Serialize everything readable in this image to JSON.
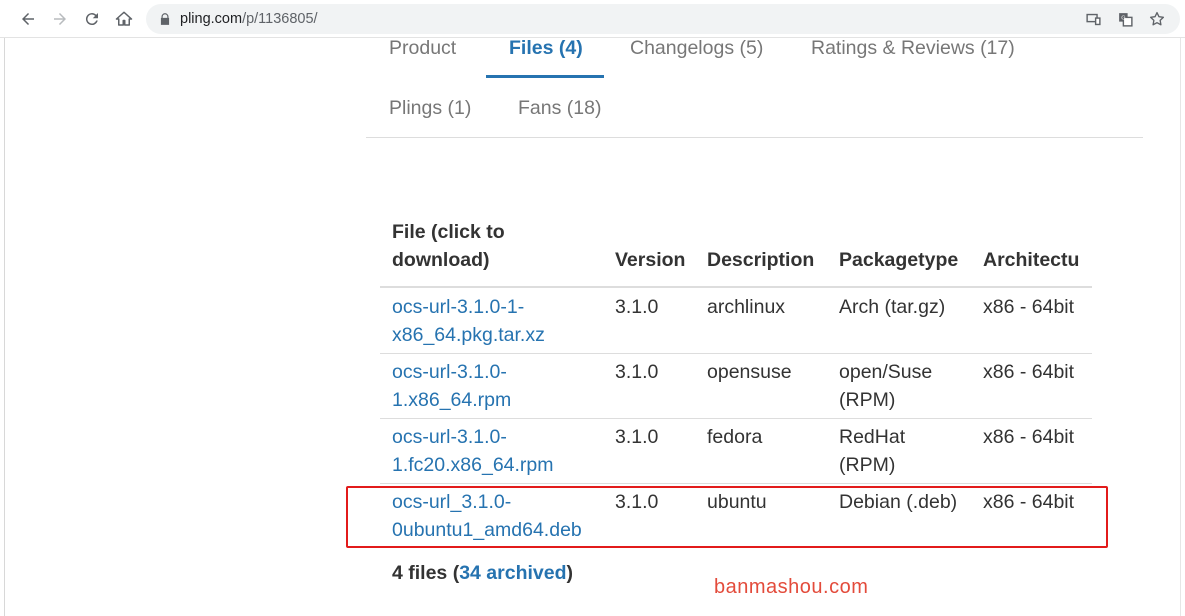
{
  "browser": {
    "url_host": "pling.com",
    "url_path": "/p/1136805/"
  },
  "tabs": [
    {
      "label": "Product"
    },
    {
      "label": "Files (4)"
    },
    {
      "label": "Changelogs (5)"
    },
    {
      "label": "Ratings & Reviews (17)"
    },
    {
      "label": "Plings (1)"
    },
    {
      "label": "Fans (18)"
    }
  ],
  "table": {
    "headers": {
      "file_line1": "File (click to",
      "file_line2": "download)",
      "version": "Version",
      "description": "Description",
      "packagetype": "Packagetype",
      "architecture": "Architectu"
    },
    "rows": [
      {
        "file_line1": "ocs-url-3.1.0-1-",
        "file_line2": "x86_64.pkg.tar.xz",
        "version": "3.1.0",
        "description": "archlinux",
        "pkg_line1": "Arch (tar.gz)",
        "pkg_line2": "",
        "arch": "x86 - 64bit"
      },
      {
        "file_line1": "ocs-url-3.1.0-",
        "file_line2": "1.x86_64.rpm",
        "version": "3.1.0",
        "description": "opensuse",
        "pkg_line1": "open/Suse",
        "pkg_line2": "(RPM)",
        "arch": "x86 - 64bit"
      },
      {
        "file_line1": "ocs-url-3.1.0-",
        "file_line2": "1.fc20.x86_64.rpm",
        "version": "3.1.0",
        "description": "fedora",
        "pkg_line1": "RedHat",
        "pkg_line2": "(RPM)",
        "arch": "x86 - 64bit"
      },
      {
        "file_line1": "ocs-url_3.1.0-",
        "file_line2": "0ubuntu1_amd64.deb",
        "version": "3.1.0",
        "description": "ubuntu",
        "pkg_line1": "Debian (.deb)",
        "pkg_line2": "",
        "arch": "x86 - 64bit"
      }
    ]
  },
  "summary": {
    "prefix": "4 files (",
    "archived_link": "34 archived",
    "suffix": ")"
  },
  "watermark": "banmashou.com",
  "colors": {
    "link": "#2673b0",
    "highlight": "#e21b1b",
    "watermark": "#e34b3b"
  }
}
